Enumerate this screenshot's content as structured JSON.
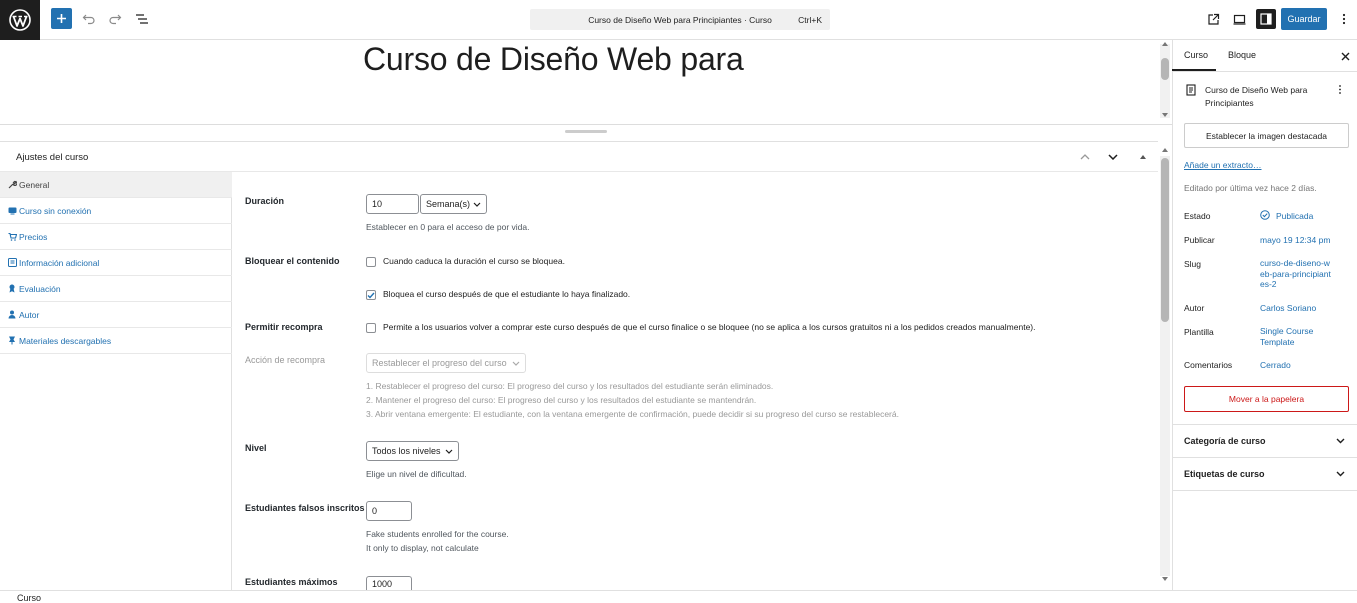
{
  "topbar": {
    "command_title": "Curso de Diseño Web para Principiantes · Curso",
    "command_shortcut": "Ctrl+K",
    "save_label": "Guardar"
  },
  "editor": {
    "post_title": "Curso de Diseño Web para"
  },
  "metabox": {
    "title": "Ajustes del curso",
    "tabs": [
      {
        "icon": "wrench-icon",
        "label": "General",
        "active": true
      },
      {
        "icon": "offline-icon",
        "label": "Curso sin conexión"
      },
      {
        "icon": "cart-icon",
        "label": "Precios"
      },
      {
        "icon": "info-icon",
        "label": "Información adicional"
      },
      {
        "icon": "award-icon",
        "label": "Evaluación"
      },
      {
        "icon": "person-icon",
        "label": "Autor"
      },
      {
        "icon": "download-icon",
        "label": "Materiales descargables"
      }
    ],
    "duration": {
      "label": "Duración",
      "value": "10",
      "unit": "Semana(s)",
      "help": "Establecer en 0 para el acceso de por vida."
    },
    "block_content": {
      "label": "Bloquear el contenido",
      "option1": "Cuando caduca la duración el curso se bloquea.",
      "option1_checked": false,
      "option2": "Bloquea el curso después de que el estudiante lo haya finalizado.",
      "option2_checked": true
    },
    "repurchase": {
      "label": "Permitir recompra",
      "option": "Permite a los usuarios volver a comprar este curso después de que el curso finalice o se bloquee (no se aplica a los cursos gratuitos ni a los pedidos creados manualmente).",
      "checked": false
    },
    "repurchase_action": {
      "label": "Acción de recompra",
      "selected": "Restablecer el progreso del curso",
      "help1": "1. Restablecer el progreso del curso: El progreso del curso y los resultados del estudiante serán eliminados.",
      "help2": "2. Mantener el progreso del curso: El progreso del curso y los resultados del estudiante se mantendrán.",
      "help3": "3. Abrir ventana emergente: El estudiante, con la ventana emergente de confirmación, puede decidir si su progreso del curso se restablecerá."
    },
    "level": {
      "label": "Nivel",
      "selected": "Todos los niveles",
      "help": "Elige un nivel de dificultad."
    },
    "fake_students": {
      "label": "Estudiantes falsos inscritos",
      "value": "0",
      "help1": "Fake students enrolled for the course.",
      "help2": "It only to display, not calculate"
    },
    "max_students": {
      "label": "Estudiantes máximos",
      "value": "1000"
    }
  },
  "sidebar": {
    "tab_course": "Curso",
    "tab_block": "Bloque",
    "post_title": "Curso de Diseño Web para Principiantes",
    "featured_image": "Establecer la imagen destacada",
    "excerpt_link": "Añade un extracto…",
    "last_edited": "Editado por última vez hace 2 días.",
    "rows": {
      "status_label": "Estado",
      "status_value": "Publicada",
      "publish_label": "Publicar",
      "publish_value": "mayo 19 12:34 pm",
      "slug_label": "Slug",
      "slug_value": "curso-de-diseno-web-para-principiantes-2",
      "author_label": "Autor",
      "author_value": "Carlos Soriano",
      "template_label": "Plantilla",
      "template_value": "Single Course Template",
      "comments_label": "Comentarios",
      "comments_value": "Cerrado"
    },
    "trash": "Mover a la papelera",
    "panel_category": "Categoría de curso",
    "panel_tags": "Etiquetas de curso"
  },
  "footer": {
    "breadcrumb": "Curso"
  },
  "colors": {
    "accent": "#2271b1",
    "danger": "#cc1818",
    "dark": "#1e1e1e"
  }
}
